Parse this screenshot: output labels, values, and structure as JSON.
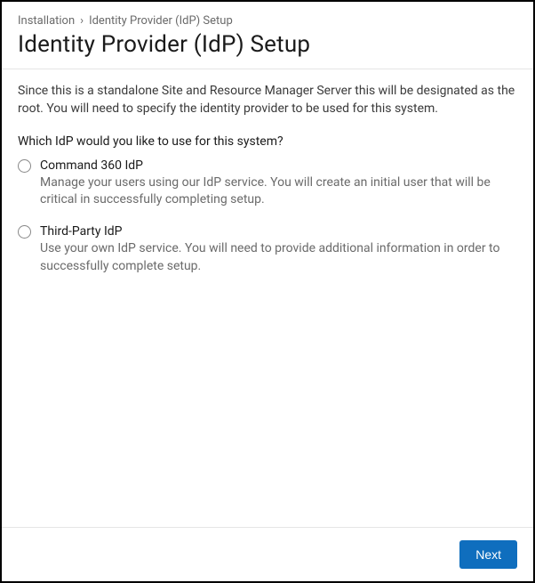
{
  "breadcrumb": {
    "root": "Installation",
    "current": "Identity Provider (IdP) Setup"
  },
  "page_title": "Identity Provider (IdP) Setup",
  "intro_text": "Since this is a standalone Site and Resource Manager Server this will be designated as the root. You will need to specify the identity provider to be used for this system.",
  "question": "Which IdP would you like to use for this system?",
  "options": [
    {
      "title": "Command 360 IdP",
      "description": "Manage your users using our IdP service. You will create an initial user that will be critical in successfully completing setup.",
      "selected": false
    },
    {
      "title": "Third-Party IdP",
      "description": "Use your own IdP service. You will need to provide additional information in order to successfully complete setup.",
      "selected": false
    }
  ],
  "footer": {
    "next_label": "Next"
  }
}
